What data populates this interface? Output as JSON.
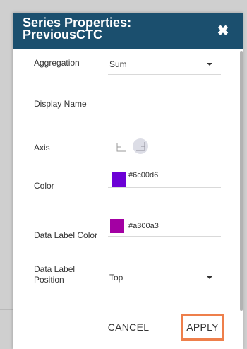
{
  "dialog": {
    "title_line1": "Series Properties:",
    "title_line2": "PreviousCTC",
    "close_icon": "✖"
  },
  "fields": {
    "aggregation": {
      "label": "Aggregation",
      "value": "Sum"
    },
    "display_name": {
      "label": "Display Name",
      "value": ""
    },
    "axis": {
      "label": "Axis",
      "options": [
        "left-axis-icon",
        "right-axis-icon"
      ],
      "selected": "right-axis-icon"
    },
    "color": {
      "label": "Color",
      "value": "#6c00d6"
    },
    "data_label_color": {
      "label": "Data Label Color",
      "value": "#a300a3"
    },
    "data_label_position": {
      "label_line1": "Data Label",
      "label_line2": "Position",
      "value": "Top"
    }
  },
  "buttons": {
    "cancel": "CANCEL",
    "apply": "APPLY"
  },
  "colors": {
    "header_bg": "#1b4f6e",
    "apply_highlight": "#ee7f4b"
  }
}
